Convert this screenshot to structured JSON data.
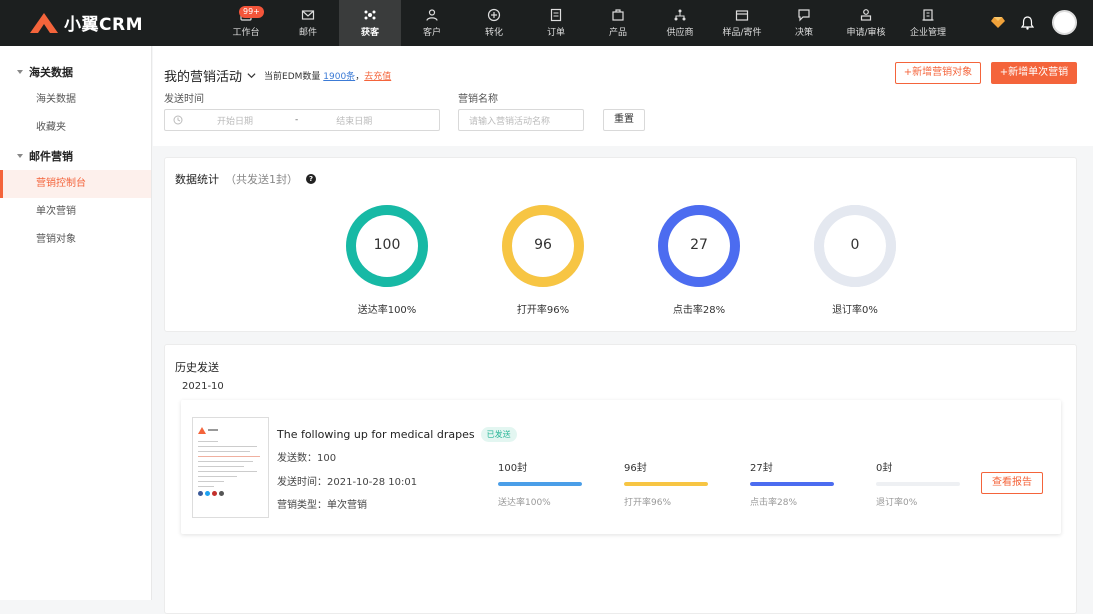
{
  "brand": {
    "name": "小翼CRM",
    "accent": "#f4643b"
  },
  "nav": [
    {
      "label": "工作台",
      "icon": "dashboard-icon",
      "badge": "99+"
    },
    {
      "label": "邮件",
      "icon": "mail-icon"
    },
    {
      "label": "获客",
      "icon": "acquire-icon",
      "active": true
    },
    {
      "label": "客户",
      "icon": "customer-icon"
    },
    {
      "label": "转化",
      "icon": "convert-icon"
    },
    {
      "label": "订单",
      "icon": "order-icon"
    },
    {
      "label": "产品",
      "icon": "product-icon"
    },
    {
      "label": "供应商",
      "icon": "supplier-icon"
    },
    {
      "label": "样品/寄件",
      "icon": "sample-icon"
    },
    {
      "label": "决策",
      "icon": "decision-icon"
    },
    {
      "label": "申请/审核",
      "icon": "approval-icon"
    },
    {
      "label": "企业管理",
      "icon": "company-icon"
    }
  ],
  "sidebar": {
    "groups": [
      {
        "label": "海关数据",
        "items": [
          "海关数据",
          "收藏夹"
        ]
      },
      {
        "label": "邮件营销",
        "items": [
          "营销控制台",
          "单次营销",
          "营销对象"
        ]
      }
    ],
    "active_item": "营销控制台"
  },
  "header": {
    "title": "我的营销活动",
    "edm_prefix": "当前EDM数量",
    "edm_count": "1900条",
    "edm_sep": "，",
    "recharge": "去充值",
    "btn_add_target": "+新增营销对象",
    "btn_add_single": "+新增单次营销",
    "send_time_label": "发送时间",
    "start_placeholder": "开始日期",
    "date_sep": "-",
    "end_placeholder": "结束日期",
    "name_label": "营销名称",
    "name_placeholder": "请输入营销活动名称",
    "reset": "重置"
  },
  "stats": {
    "title": "数据统计",
    "subtitle": "（共发送1封）",
    "help": "?",
    "rings": [
      {
        "value": "100",
        "label": "送达率100%",
        "pct": 1.0,
        "color": "#17b9a5"
      },
      {
        "value": "96",
        "label": "打开率96%",
        "pct": 1.0,
        "color": "#f7c543"
      },
      {
        "value": "27",
        "label": "点击率28%",
        "pct": 1.0,
        "color": "#4c6cf0"
      },
      {
        "value": "0",
        "label": "退订率0%",
        "pct": 1.0,
        "color": "#e4e8f0"
      }
    ]
  },
  "history": {
    "title": "历史发送",
    "month": "2021-10",
    "item": {
      "title": "The following up for medical drapes",
      "status": "已发送",
      "sent_count": "发送数：100",
      "sent_time": "发送时间：2021-10-28 10:01",
      "type": "营销类型：单次营销",
      "metrics": [
        {
          "value": "100封",
          "label": "送达率100%",
          "pct": 1.0,
          "color": "#4a9ee8"
        },
        {
          "value": "96封",
          "label": "打开率96%",
          "pct": 1.0,
          "color": "#f7c543"
        },
        {
          "value": "27封",
          "label": "点击率28%",
          "pct": 1.0,
          "color": "#4c6cf0"
        },
        {
          "value": "0封",
          "label": "退订率0%",
          "pct": 0.0,
          "color": "#e4e8f0"
        }
      ],
      "report_button": "查看报告"
    }
  }
}
